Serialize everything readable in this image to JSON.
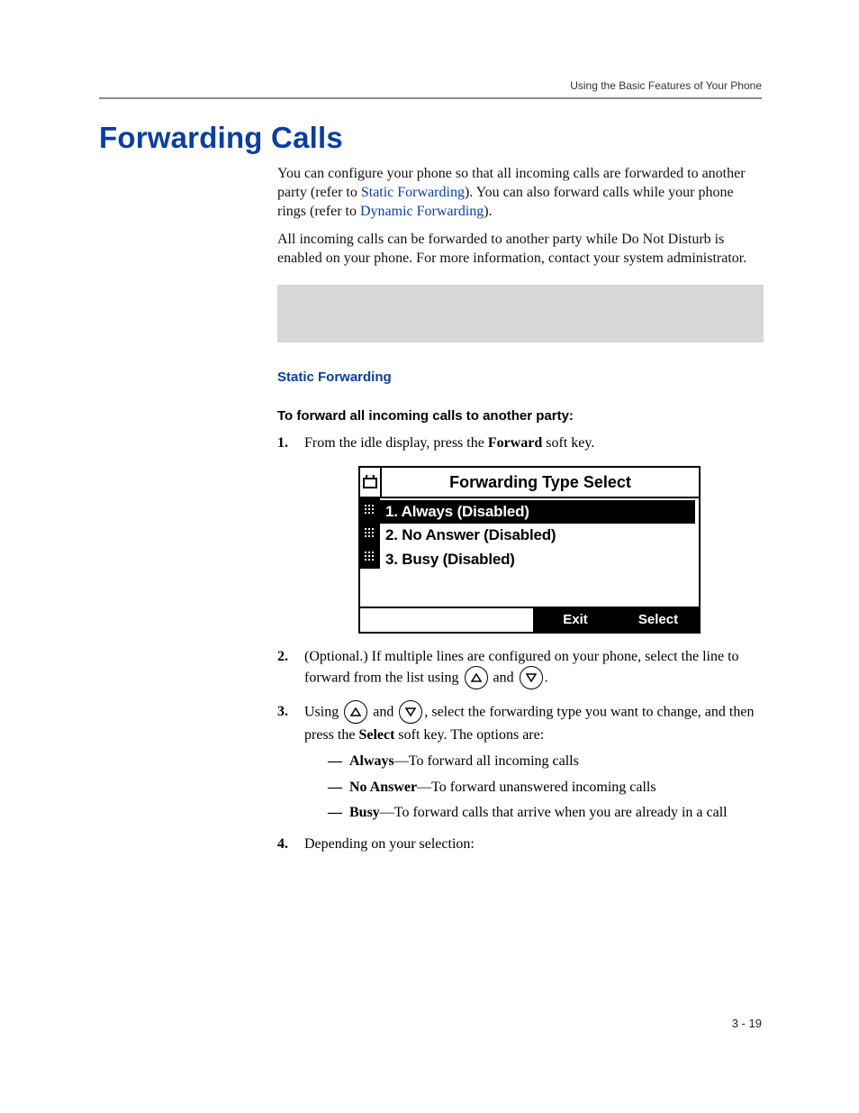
{
  "running_header": "Using the Basic Features of Your Phone",
  "section_title": "Forwarding Calls",
  "intro": {
    "p1_a": "You can configure your phone so that all incoming calls are forwarded to another party (refer to ",
    "p1_link1": "Static Forwarding",
    "p1_b": "). You can also forward calls while your phone rings (refer to ",
    "p1_link2": "Dynamic Forwarding",
    "p1_c": ").",
    "p2": "All incoming calls can be forwarded to another party while Do Not Disturb is enabled on your phone. For more information, contact your system administrator."
  },
  "subhead": "Static Forwarding",
  "task_heading": "To forward all incoming calls to another party:",
  "steps": {
    "s1_a": "From the idle display, press the ",
    "s1_bold": "Forward",
    "s1_b": " soft key.",
    "s2_a": "(Optional.) If multiple lines are configured on your phone, select the line to forward from the list using ",
    "s2_and": " and ",
    "s2_end": ".",
    "s3_a": "Using ",
    "s3_and": " and ",
    "s3_b": ", select the forwarding type you want to change, and then press the ",
    "s3_bold": "Select",
    "s3_c": " soft key. The options are:",
    "s4": "Depending on your selection:"
  },
  "options": [
    {
      "bold": "Always",
      "rest": "—To forward all incoming calls"
    },
    {
      "bold": "No Answer",
      "rest": "—To forward unanswered incoming calls"
    },
    {
      "bold": "Busy",
      "rest": "—To forward calls that arrive when you are already in a call"
    }
  ],
  "lcd": {
    "title": "Forwarding Type Select",
    "items": [
      "1. Always (Disabled)",
      "2. No Answer (Disabled)",
      "3. Busy (Disabled)"
    ],
    "soft_exit": "Exit",
    "soft_select": "Select"
  },
  "pagenum": "3 - 19"
}
